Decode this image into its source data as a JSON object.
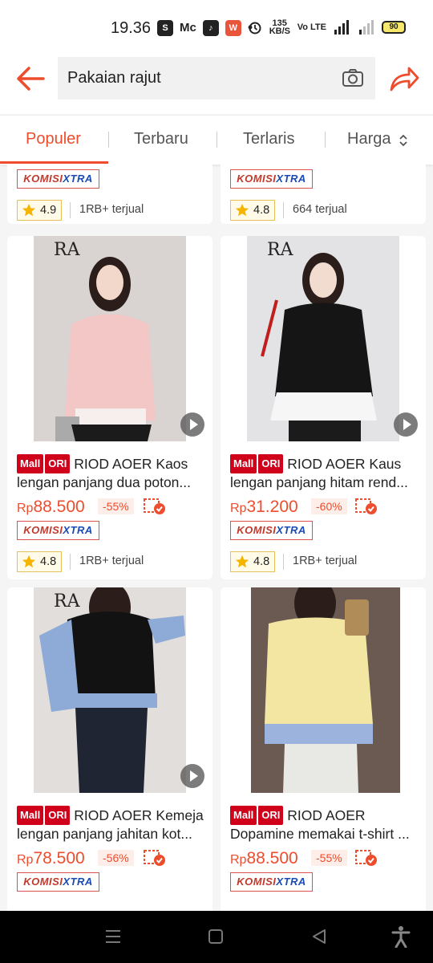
{
  "status_bar": {
    "time": "19.36",
    "network_speed": "135 KB/S",
    "battery": "90"
  },
  "search": {
    "query": "Pakaian rajut"
  },
  "tabs": [
    {
      "label": "Populer"
    },
    {
      "label": "Terbaru"
    },
    {
      "label": "Terlaris"
    },
    {
      "label": "Harga"
    }
  ],
  "colors": {
    "accent": "#ee4d2d",
    "mall_badge": "#d0011b",
    "komisi_blue": "#1a4bb5"
  },
  "top_partial": [
    {
      "komisi": "KOMISI",
      "xtra": "XTRA",
      "rating": "4.9",
      "sold": "1RB+ terjual"
    },
    {
      "komisi": "KOMISI",
      "xtra": "XTRA",
      "rating": "4.8",
      "sold": "664 terjual"
    }
  ],
  "products": [
    {
      "image_text": "RA",
      "mall": "Mall",
      "ori": "ORI",
      "title_line1": "RIOD AOER Kaos",
      "title_line2": "lengan panjang dua poton...",
      "currency": "Rp",
      "price": "88.500",
      "discount": "-55%",
      "komisi": "KOMISI",
      "xtra": "XTRA",
      "rating": "4.8",
      "sold": "1RB+ terjual"
    },
    {
      "image_text": "RA",
      "mall": "Mall",
      "ori": "ORI",
      "title_line1": "RIOD AOER Kaus",
      "title_line2": "lengan panjang hitam rend...",
      "currency": "Rp",
      "price": "31.200",
      "discount": "-60%",
      "komisi": "KOMISI",
      "xtra": "XTRA",
      "rating": "4.8",
      "sold": "1RB+ terjual"
    },
    {
      "image_text": "RA",
      "mall": "Mall",
      "ori": "ORI",
      "title_line1": "RIOD AOER Kemeja",
      "title_line2": "lengan panjang jahitan kot...",
      "currency": "Rp",
      "price": "78.500",
      "discount": "-56%",
      "komisi": "KOMISI",
      "xtra": "XTRA"
    },
    {
      "mall": "Mall",
      "ori": "ORI",
      "title_line1": "RIOD AOER",
      "title_line2": "Dopamine memakai t-shirt ...",
      "currency": "Rp",
      "price": "88.500",
      "discount": "-55%",
      "komisi": "KOMISI",
      "xtra": "XTRA"
    }
  ]
}
